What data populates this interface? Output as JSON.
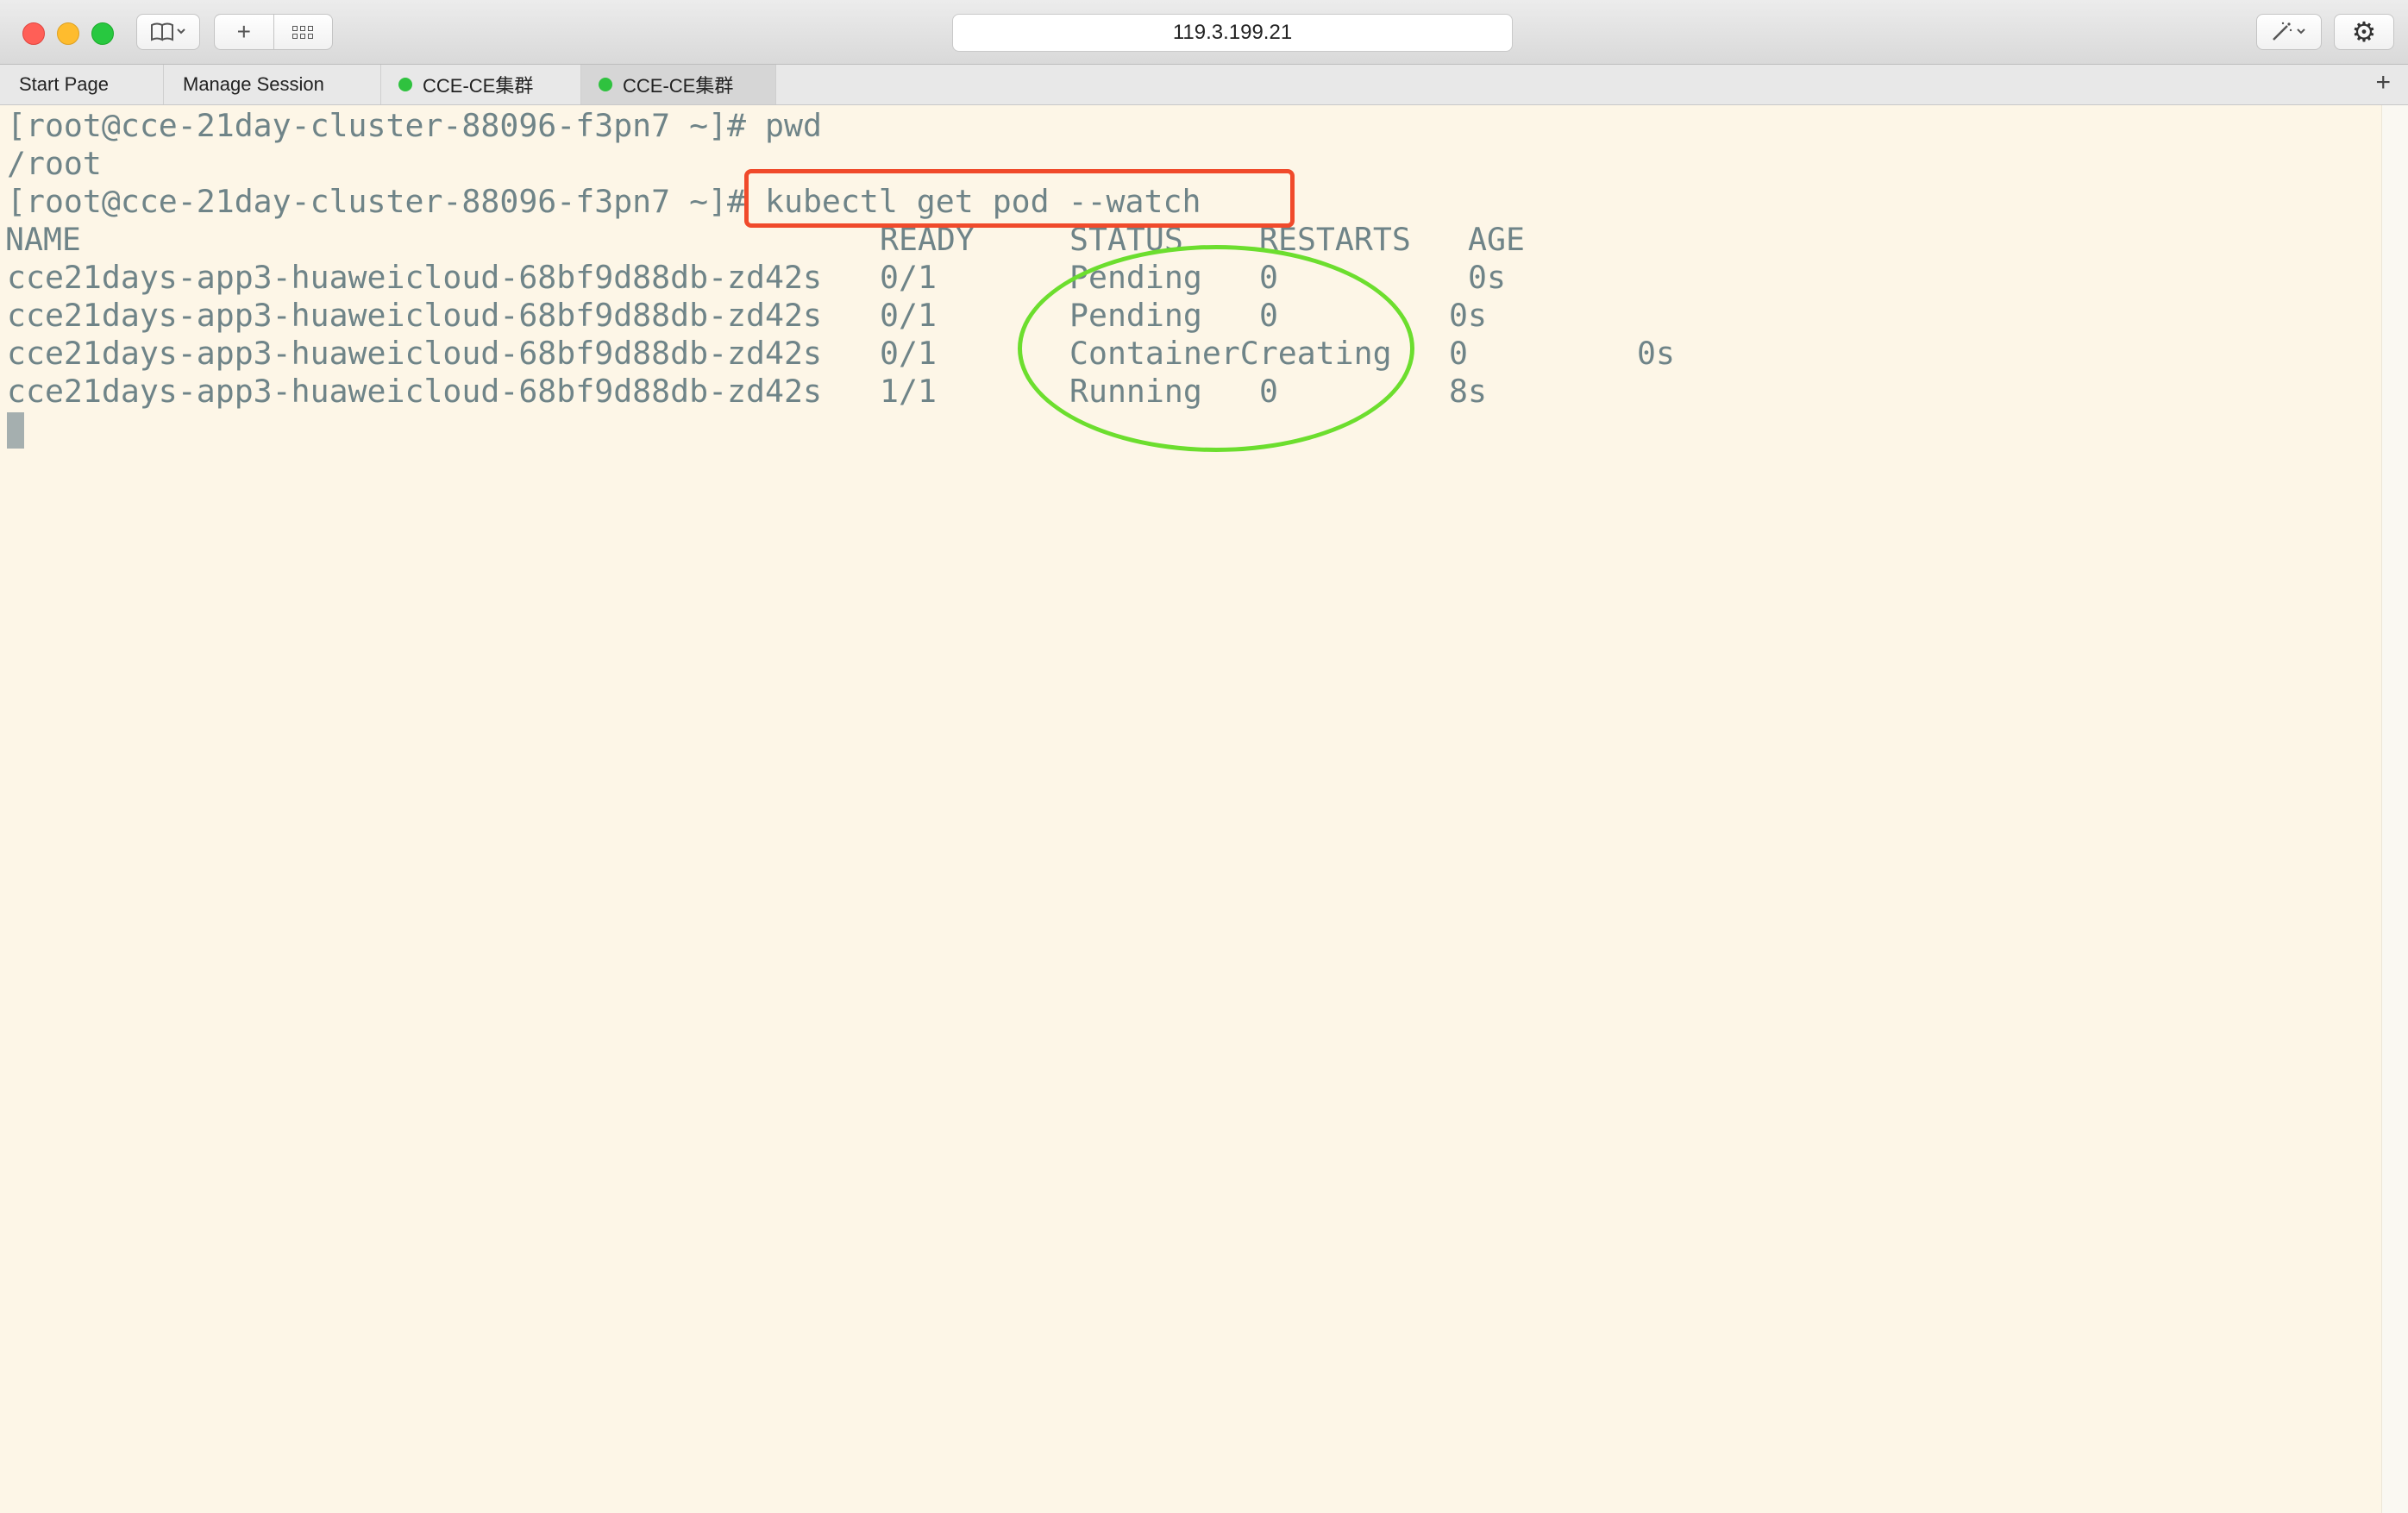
{
  "window": {
    "address": "119.3.199.21",
    "toolbar": {
      "bookmarks_icon": "book-icon",
      "new_tab_label": "+",
      "grid_icon": "grid-icon",
      "magic_icon": "✨",
      "settings_icon": "⚙"
    }
  },
  "tabs": [
    {
      "label": "Start Page",
      "active": false,
      "status": false
    },
    {
      "label": "Manage Session",
      "active": false,
      "status": false
    },
    {
      "label": "CCE-CE集群",
      "active": false,
      "status": true
    },
    {
      "label": "CCE-CE集群",
      "active": true,
      "status": true
    }
  ],
  "tab_add_label": "+",
  "terminal": {
    "lines": [
      "[root@cce-21day-cluster-88096-f3pn7 ~]# pwd",
      "/root",
      "[root@cce-21day-cluster-88096-f3pn7 ~]# kubectl get pod --watch"
    ],
    "table": {
      "headers": {
        "name": "NAME",
        "ready": "READY",
        "status": "STATUS",
        "restarts": "RESTARTS",
        "age": "AGE"
      },
      "rows": [
        {
          "name": "cce21days-app3-huaweicloud-68bf9d88db-zd42s",
          "ready": "0/1",
          "status": "Pending",
          "restarts": "0",
          "age": "0s"
        },
        {
          "name": "cce21days-app3-huaweicloud-68bf9d88db-zd42s",
          "ready": "0/1",
          "status": "Pending",
          "restarts": "0",
          "age": "0s"
        },
        {
          "name": "cce21days-app3-huaweicloud-68bf9d88db-zd42s",
          "ready": "0/1",
          "status": "ContainerCreating",
          "restarts": "0",
          "age": "0s"
        },
        {
          "name": "cce21days-app3-huaweicloud-68bf9d88db-zd42s",
          "ready": "1/1",
          "status": "Running",
          "restarts": "0",
          "age": "8s"
        }
      ]
    }
  },
  "colors": {
    "terminal_bg": "#fdf6e7",
    "terminal_fg": "#6f8488",
    "annotation_red": "#f04a2b",
    "annotation_green": "#6cde2e",
    "status_dot": "#2fc23f"
  }
}
